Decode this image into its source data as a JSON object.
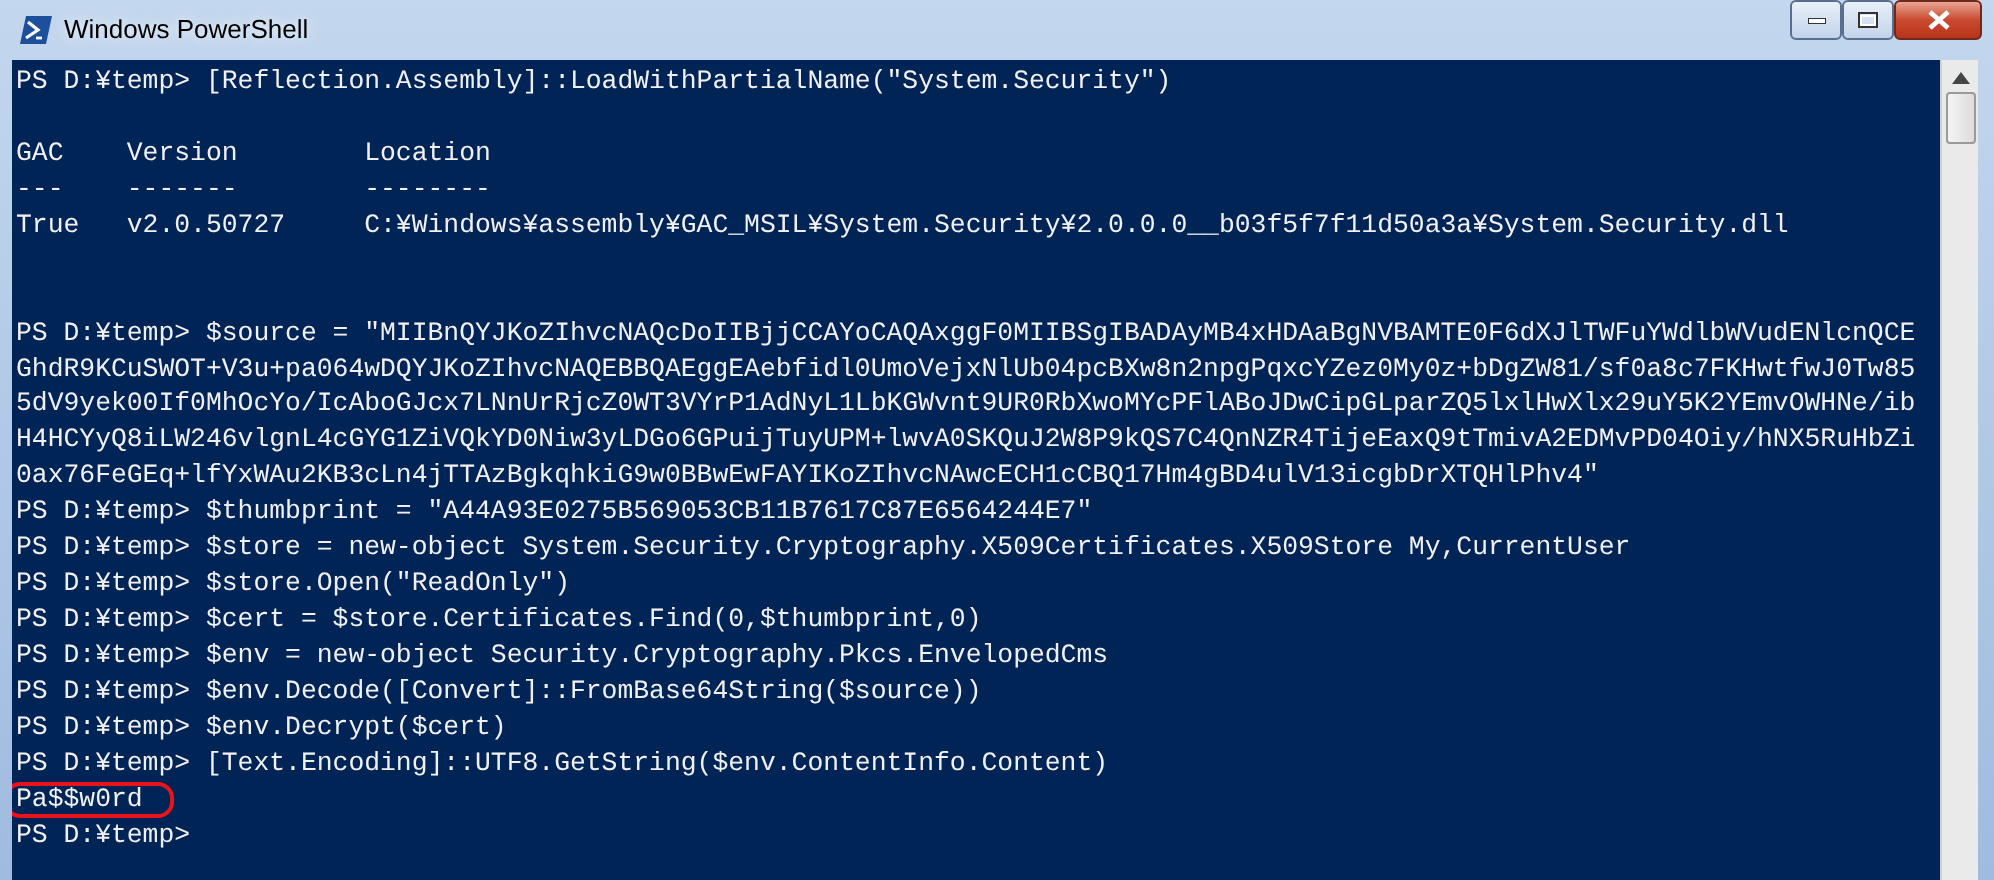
{
  "window": {
    "title": "Windows PowerShell"
  },
  "console": {
    "lines": [
      {
        "kind": "text",
        "text": "PS D:¥temp> [Reflection.Assembly]::LoadWithPartialName(\"System.Security\")"
      },
      {
        "kind": "blank"
      },
      {
        "kind": "text",
        "text": "GAC    Version        Location"
      },
      {
        "kind": "text",
        "text": "---    -------        --------"
      },
      {
        "kind": "text",
        "text": "True   v2.0.50727     C:¥Windows¥assembly¥GAC_MSIL¥System.Security¥2.0.0.0__b03f5f7f11d50a3a¥System.Security.dll"
      },
      {
        "kind": "blank"
      },
      {
        "kind": "blank"
      },
      {
        "kind": "text",
        "text": "PS D:¥temp> $source = \"MIIBnQYJKoZIhvcNAQcDoIIBjjCCAYoCAQAxggF0MIIBSgIBADAyMB4xHDAaBgNVBAMTE0F6dXJlTWFuYWdlbWVudENlcnQCE"
      },
      {
        "kind": "text",
        "text": "GhdR9KCuSWOT+V3u+pa064wDQYJKoZIhvcNAQEBBQAEggEAebfidl0UmoVejxNlUb04pcBXw8n2npgPqxcYZez0My0z+bDgZW81/sf0a8c7FKHwtfwJ0Tw85"
      },
      {
        "kind": "text",
        "text": "5dV9yek00If0MhOcYo/IcAboGJcx7LNnUrRjcZ0WT3VYrP1AdNyL1LbKGWvnt9UR0RbXwoMYcPFlABoJDwCipGLparZQ5lxlHwXlx29uY5K2YEmvOWHNe/ib"
      },
      {
        "kind": "text",
        "text": "H4HCYyQ8iLW246vlgnL4cGYG1ZiVQkYD0Niw3yLDGo6GPuijTuyUPM+lwvA0SKQuJ2W8P9kQS7C4QnNZR4TijeEaxQ9tTmivA2EDMvPD04Oiy/hNX5RuHbZi"
      },
      {
        "kind": "text",
        "text": "0ax76FeGEq+lfYxWAu2KB3cLn4jTTAzBgkqhkiG9w0BBwEwFAYIKoZIhvcNAwcECH1cCBQ17Hm4gBD4ulV13icgbDrXTQHlPhv4\""
      },
      {
        "kind": "text",
        "text": "PS D:¥temp> $thumbprint = \"A44A93E0275B569053CB11B7617C87E6564244E7\""
      },
      {
        "kind": "text",
        "text": "PS D:¥temp> $store = new-object System.Security.Cryptography.X509Certificates.X509Store My,CurrentUser"
      },
      {
        "kind": "text",
        "text": "PS D:¥temp> $store.Open(\"ReadOnly\")"
      },
      {
        "kind": "text",
        "text": "PS D:¥temp> $cert = $store.Certificates.Find(0,$thumbprint,0)"
      },
      {
        "kind": "text",
        "text": "PS D:¥temp> $env = new-object Security.Cryptography.Pkcs.EnvelopedCms"
      },
      {
        "kind": "text",
        "text": "PS D:¥temp> $env.Decode([Convert]::FromBase64String($source))"
      },
      {
        "kind": "text",
        "text": "PS D:¥temp> $env.Decrypt($cert)"
      },
      {
        "kind": "text",
        "text": "PS D:¥temp> [Text.Encoding]::UTF8.GetString($env.ContentInfo.Content)"
      },
      {
        "kind": "text",
        "text": "Pa$$w0rd",
        "highlighted": true
      },
      {
        "kind": "text",
        "text": "PS D:¥temp>"
      }
    ]
  }
}
